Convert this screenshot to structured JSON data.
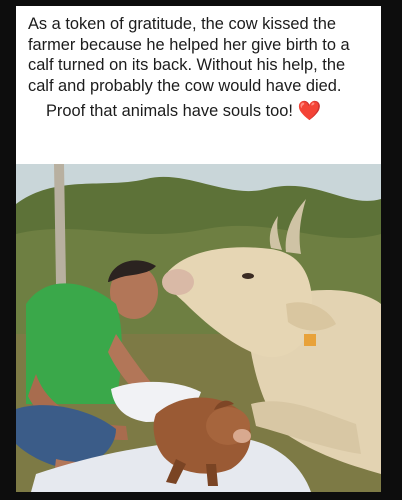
{
  "post": {
    "caption": "As a token of gratitude, the cow kissed the farmer because he helped her give birth to a calf turned on its back. Without his help, the calf and probably the cow would have died.",
    "tagline": "Proof that animals have souls too!",
    "tagline_emoji": "❤️"
  },
  "photo": {
    "description_icon": "photo-scene",
    "colors": {
      "sky": "#c9d6d9",
      "trees": "#5d7238",
      "grass": "#7d7a45",
      "cow": "#e3d3b2",
      "shirt": "#3aa84a",
      "skin": "#b27658",
      "calf": "#9a5a34",
      "cloth": "#e6e9ef"
    }
  }
}
